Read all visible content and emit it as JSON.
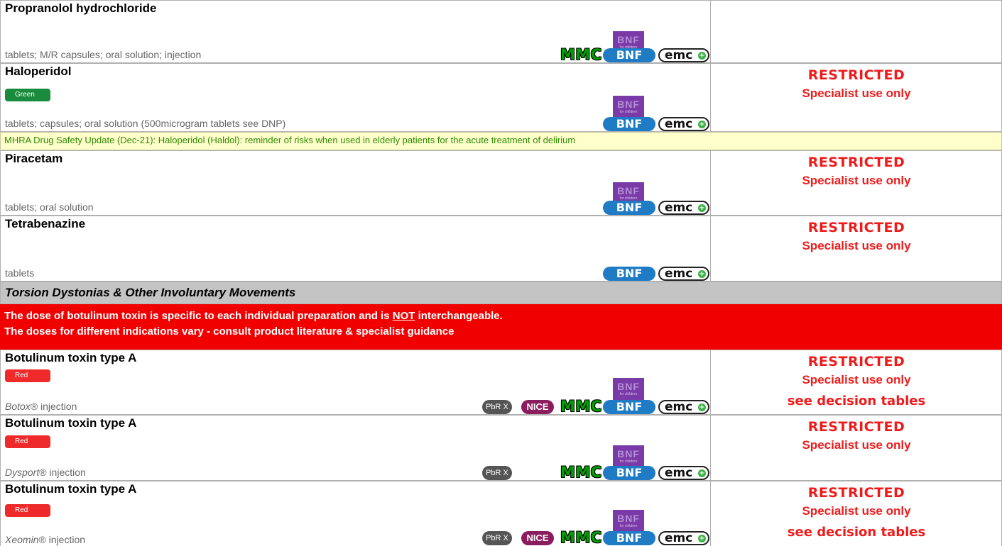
{
  "icons": {
    "bnfc_title": "BNF",
    "bnfc_sub": "for children",
    "mmc": "MMC",
    "bnf": "BNF",
    "emc": "emc",
    "emc_plus": "+",
    "pbr": "PbR X",
    "nice": "NICE"
  },
  "status_labels": {
    "restricted": "RESTRICTED",
    "specialist": "Specialist use only",
    "decision": "see decision tables"
  },
  "drugs": {
    "propranolol": {
      "name": "Propranolol hydrochloride",
      "forms": "tablets; M/R capsules; oral solution; injection"
    },
    "haloperidol": {
      "name": "Haloperidol",
      "badge": "Green",
      "forms": "tablets; capsules; oral solution (500microgram tablets see DNP)"
    },
    "piracetam": {
      "name": "Piracetam",
      "forms": "tablets; oral solution"
    },
    "tetrabenazine": {
      "name": "Tetrabenazine",
      "forms": "tablets"
    },
    "botox": {
      "name": "Botulinum toxin type A",
      "badge": "Red",
      "brand": "Botox",
      "forms": "® injection"
    },
    "dysport": {
      "name": "Botulinum toxin type A",
      "badge": "Red",
      "brand": "Dysport",
      "forms": "® injection"
    },
    "xeomin": {
      "name": "Botulinum toxin type A",
      "badge": "Red",
      "brand": "Xeomin",
      "forms": "® injection"
    }
  },
  "mhra_alert": "MHRA Drug Safety Update (Dec-21): Haloperidol (Haldol): reminder of risks when used in elderly patients for the acute treatment of delirium",
  "section_heading": "Torsion Dystonias & Other Involuntary Movements",
  "warning": {
    "line1_before": "The dose of botulinum toxin is specific to each individual preparation and is ",
    "line1_not": "NOT",
    "line1_after": " interchangeable.",
    "line2": "The doses for different indications vary - consult product literature & specialist guidance"
  },
  "colors": {
    "restricted_red": "#ef1b1b",
    "green_badge": "#1a8a3c",
    "red_badge": "#ee2a2a",
    "bnf_blue": "#1e7bc4",
    "bnfc_purple": "#7a3aa8",
    "nice_maroon": "#8b1c5e",
    "mmc_green": "#00a000",
    "section_grey": "#c4c4c4",
    "warning_red": "#f00000",
    "mhra_yellow": "#ffffcc",
    "mhra_text": "#2e8b00"
  }
}
